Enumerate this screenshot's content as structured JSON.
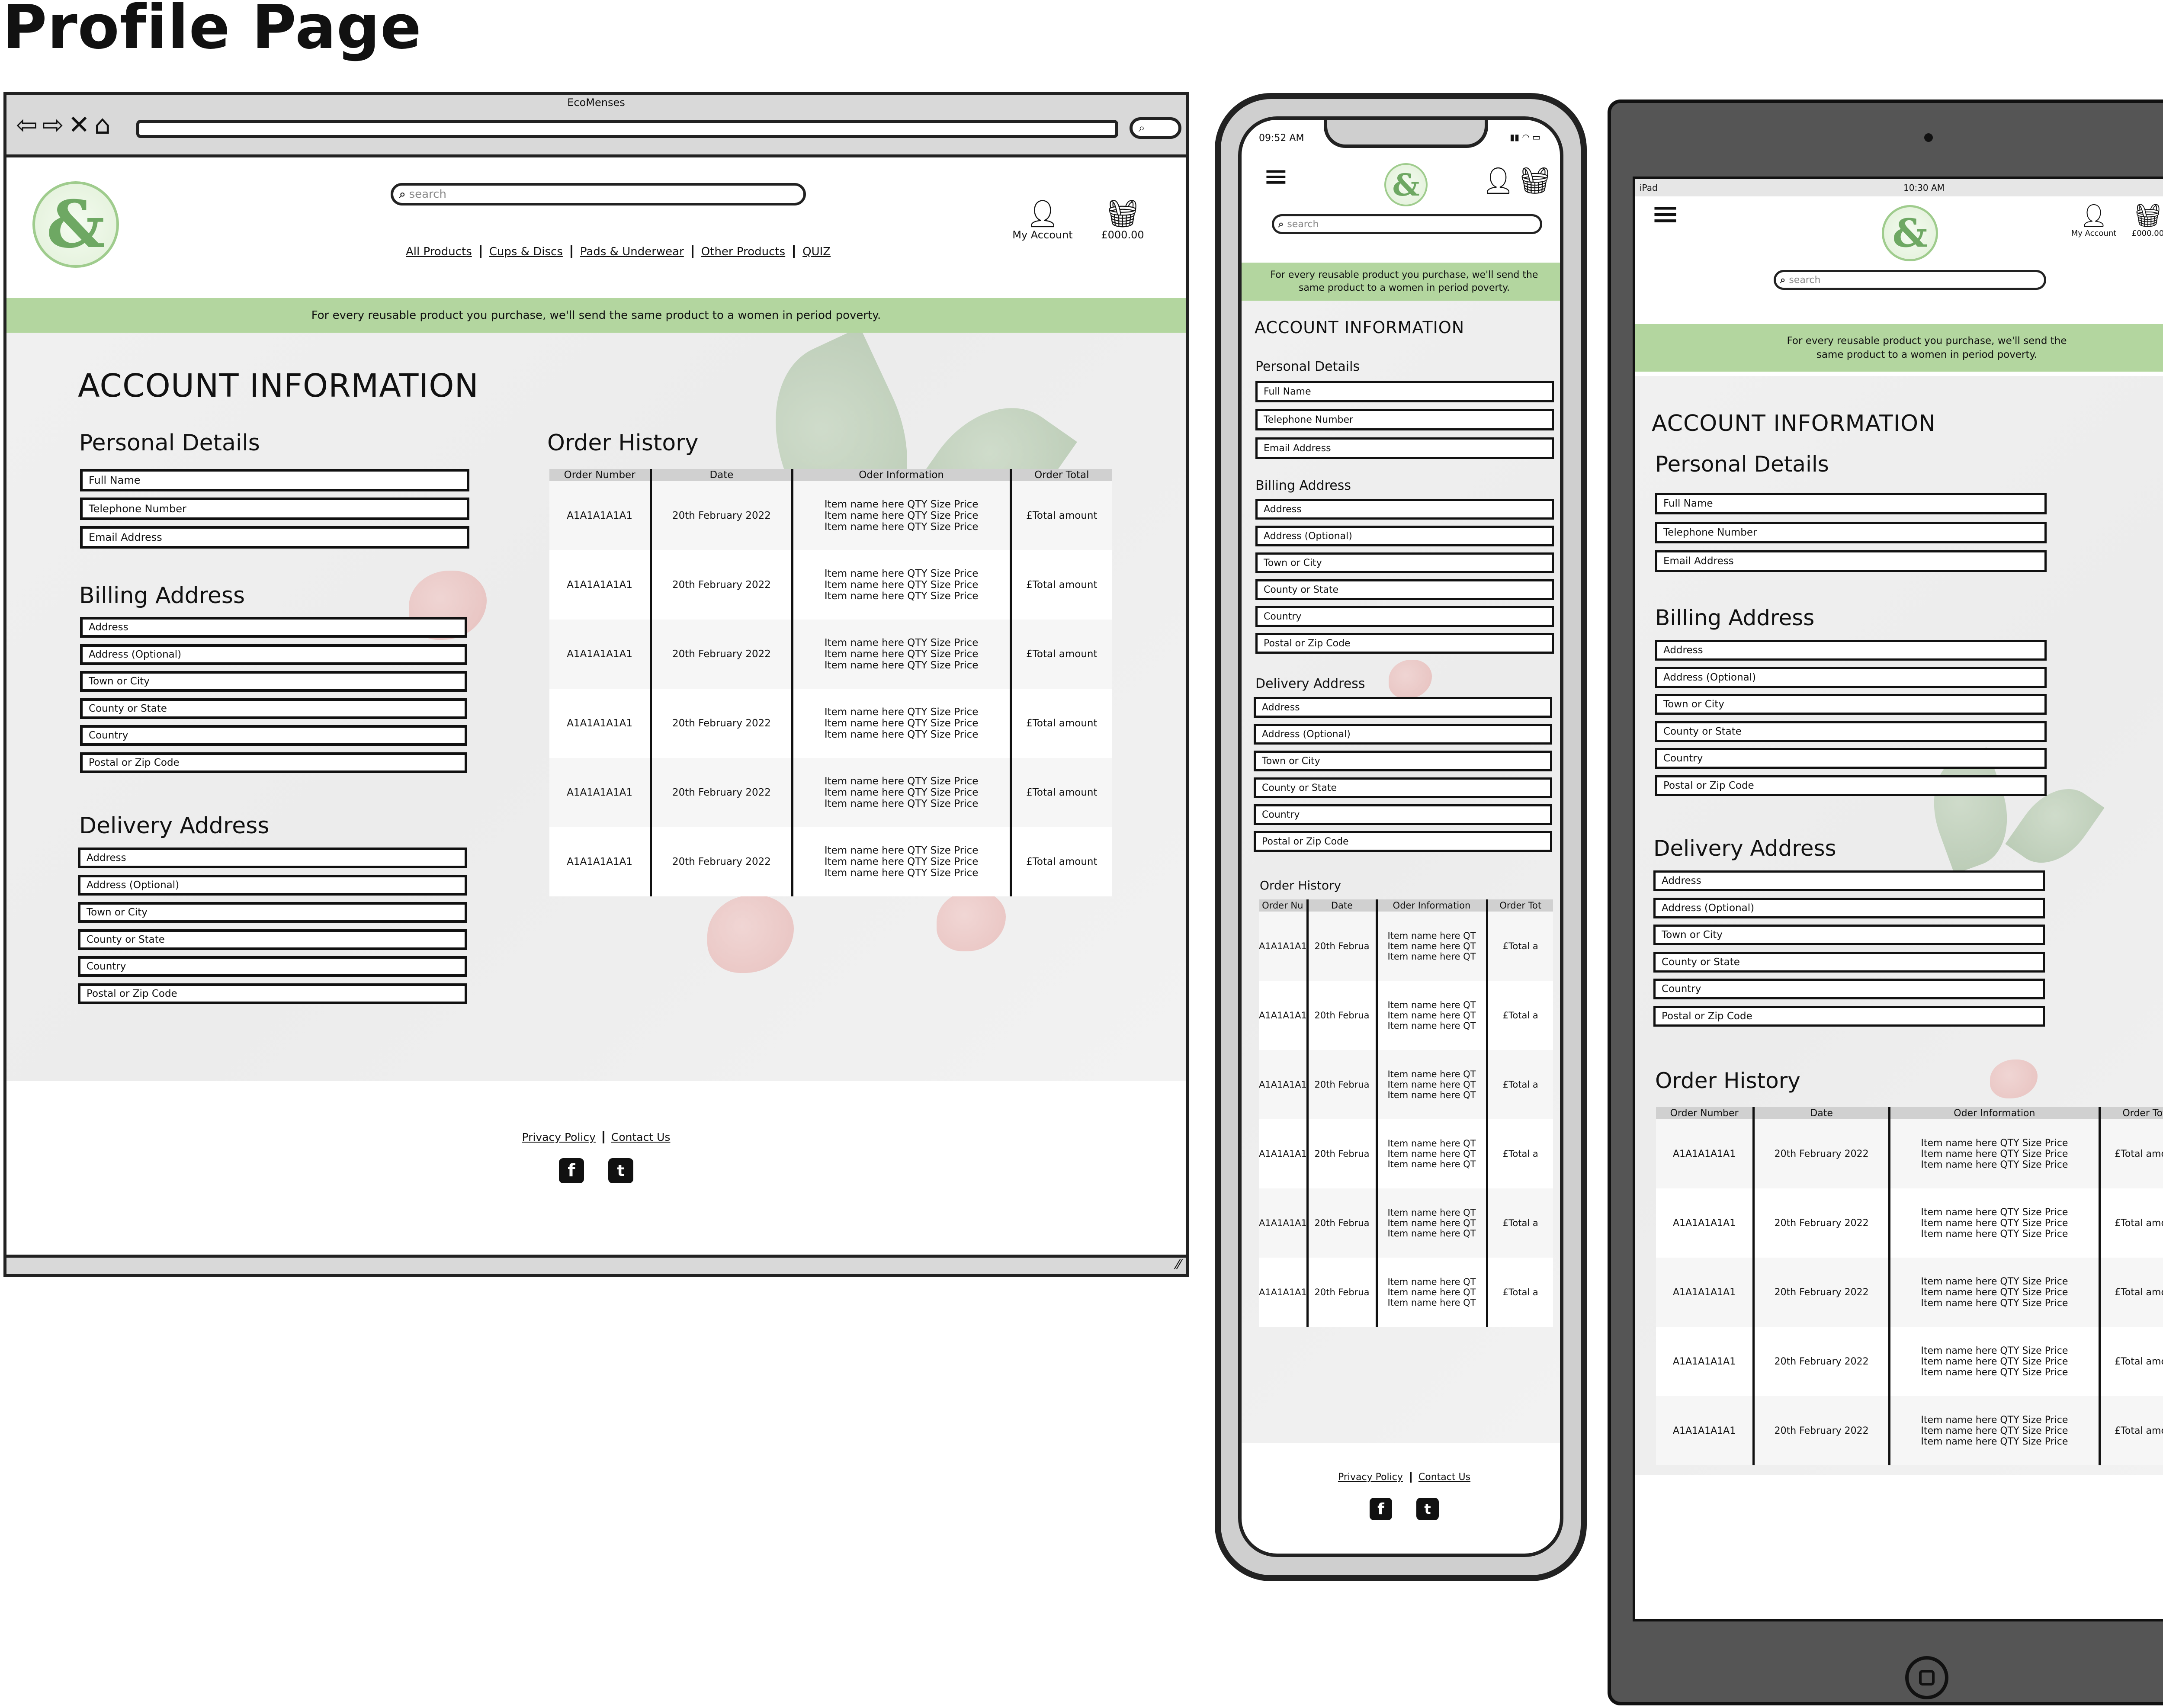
{
  "page_title": "Profile Page",
  "browser": {
    "title": "EcoMenses",
    "search_icon": "search-icon"
  },
  "search_placeholder": "search",
  "nav": [
    "All Products",
    "Cups & Discs",
    "Pads & Underwear",
    "Other Products",
    "QUIZ"
  ],
  "header": {
    "my_account": "My Account",
    "basket_total": "£000.00"
  },
  "banner": "For every reusable product you purchase, we'll send the same product to a women in period poverty.",
  "account_heading": "ACCOUNT INFORMATION",
  "personal": {
    "heading": "Personal Details",
    "fields": [
      "Full Name",
      "Telephone Number",
      "Email Address"
    ]
  },
  "billing": {
    "heading": "Billing Address",
    "fields": [
      "Address",
      "Address (Optional)",
      "Town or City",
      "County or State",
      "Country",
      "Postal or Zip Code"
    ]
  },
  "delivery": {
    "heading": "Delivery Address",
    "fields": [
      "Address",
      "Address (Optional)",
      "Town or City",
      "County or State",
      "Country",
      "Postal or Zip Code"
    ]
  },
  "orders": {
    "heading": "Order History",
    "columns": [
      "Order Number",
      "Date",
      "Oder Information",
      "Order Total"
    ],
    "phone_columns": [
      "Order Nu",
      "Date",
      "Oder Information",
      "Order Tot"
    ],
    "row": {
      "number": "A1A1A1A1A1",
      "date": "20th February 2022",
      "item": "Item name here QTY Size Price",
      "total": "£Total amount",
      "phone_number": "A1A1A1A1",
      "phone_date": "20th Februa",
      "phone_item": "Item name here QT",
      "phone_total": "£Total a"
    }
  },
  "footer": {
    "privacy": "Privacy Policy",
    "contact": "Contact Us"
  },
  "phone": {
    "time": "09:52 AM"
  },
  "tablet": {
    "device": "iPad",
    "time": "10:30 AM"
  },
  "colors": {
    "banner": "#b3d69f",
    "logo": "#6ea863"
  }
}
